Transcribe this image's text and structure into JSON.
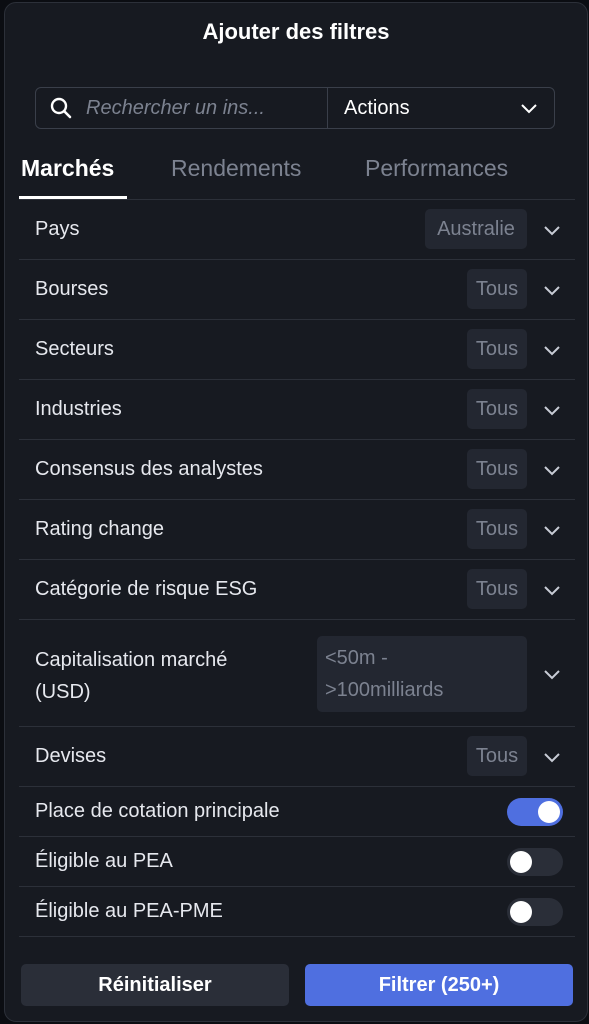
{
  "header": {
    "title": "Ajouter des filtres"
  },
  "search": {
    "placeholder": "Rechercher un ins...",
    "type_value": "Actions"
  },
  "tabs": [
    {
      "label": "Marchés",
      "active": true
    },
    {
      "label": "Rendements",
      "active": false
    },
    {
      "label": "Performances",
      "active": false
    }
  ],
  "filters": [
    {
      "label": "Pays",
      "value": "Australie"
    },
    {
      "label": "Bourses",
      "value": "Tous"
    },
    {
      "label": "Secteurs",
      "value": "Tous"
    },
    {
      "label": "Industries",
      "value": "Tous"
    },
    {
      "label": "Consensus des analystes",
      "value": "Tous"
    },
    {
      "label": "Rating change",
      "value": "Tous"
    },
    {
      "label": "Catégorie de risque ESG",
      "value": "Tous"
    },
    {
      "label_line1": "Capitalisation marché",
      "label_line2": "(USD)",
      "value_line1": "<50m -",
      "value_line2": ">100milliards"
    },
    {
      "label": "Devises",
      "value": "Tous"
    }
  ],
  "toggles": [
    {
      "label": "Place de cotation principale",
      "on": true
    },
    {
      "label": "Éligible au PEA",
      "on": false
    },
    {
      "label": "Éligible au PEA-PME",
      "on": false
    }
  ],
  "footer": {
    "reset_label": "Réinitialiser",
    "filter_label": "Filtrer (250+)"
  },
  "colors": {
    "accent": "#4f6fe0",
    "panel": "#171a21",
    "pill": "#232731"
  }
}
